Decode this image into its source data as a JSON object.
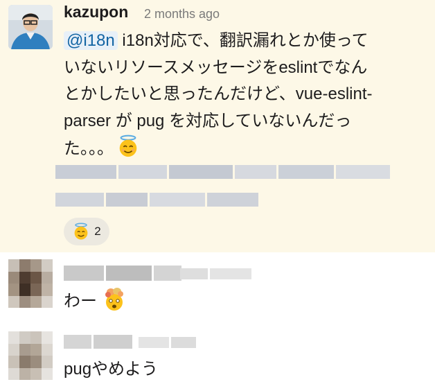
{
  "message": {
    "author": "kazupon",
    "timestamp": "2 months ago",
    "mention": "@i18n",
    "text_line1": " i18n対応で、翻訳漏れとか使って",
    "text_line2": "いないリソースメッセージをeslintでなん",
    "text_line3": "とかしたいと思ったんだけど、vue-eslint-",
    "text_line4": "parser が pug を対応していないんだっ",
    "text_line5": "た。。。",
    "emoji": "innocent-face",
    "reaction": {
      "emoji": "innocent-face",
      "count": "2"
    }
  },
  "replies": [
    {
      "text": "わー",
      "emoji": "exploding-head"
    },
    {
      "text": "pugやめよう"
    }
  ],
  "colors": {
    "highlight": "#fdf8e7",
    "mention_bg": "#e8f0f8",
    "mention_text": "#1264a3",
    "reaction_bg": "#ece9e0"
  }
}
